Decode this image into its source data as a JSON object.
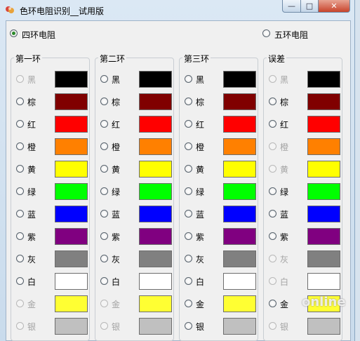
{
  "window": {
    "title": "色环电阻识别__试用版",
    "min_glyph": "—",
    "max_glyph": "□",
    "close_glyph": "✕"
  },
  "mode": {
    "four_band": "四环电阻",
    "five_band": "五环电阻",
    "selected": "four_band"
  },
  "groups": [
    {
      "title": "第一环",
      "disabled": [
        0,
        10,
        11
      ]
    },
    {
      "title": "第二环",
      "disabled": [
        10,
        11
      ]
    },
    {
      "title": "第三环",
      "disabled": []
    },
    {
      "title": "误差",
      "disabled": [
        0,
        3,
        4,
        8,
        9,
        11
      ]
    }
  ],
  "colors": [
    {
      "label": "黑",
      "hex": "#000000"
    },
    {
      "label": "棕",
      "hex": "#800000"
    },
    {
      "label": "红",
      "hex": "#ff0000"
    },
    {
      "label": "橙",
      "hex": "#ff8000"
    },
    {
      "label": "黄",
      "hex": "#ffff00"
    },
    {
      "label": "绿",
      "hex": "#00ff00"
    },
    {
      "label": "蓝",
      "hex": "#0000ff"
    },
    {
      "label": "紫",
      "hex": "#800080"
    },
    {
      "label": "灰",
      "hex": "#808080"
    },
    {
      "label": "白",
      "hex": "#ffffff"
    },
    {
      "label": "金",
      "hex": "#ffff33"
    },
    {
      "label": "银",
      "hex": "#c0c0c0"
    }
  ],
  "watermark": "online"
}
